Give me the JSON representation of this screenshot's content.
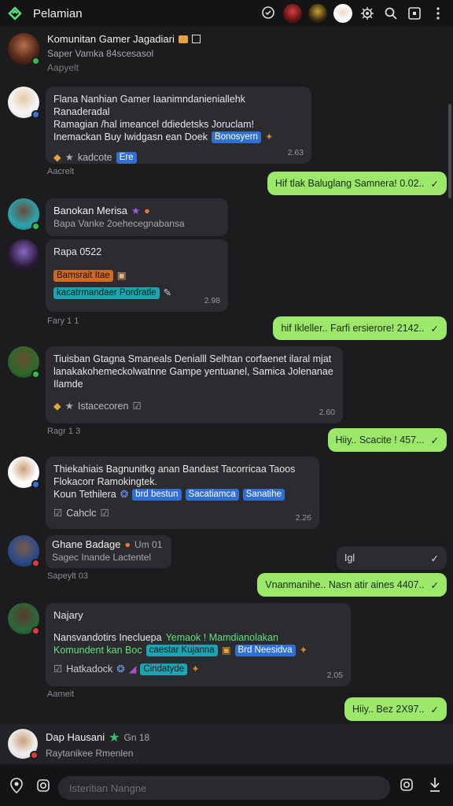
{
  "app": {
    "title": "Pelamian"
  },
  "header": {
    "icons": [
      "logo-icon",
      "chat-bubble-icon",
      "avatar-red",
      "avatar-dark",
      "avatar-white",
      "gear-icon",
      "search-icon",
      "window-icon",
      "more-icon"
    ]
  },
  "colors": {
    "bg": "#1c1c1e",
    "bubble": "#2c2c30",
    "outgoing": "#9be86a",
    "tag_blue": "#2f6fd6",
    "tag_cyan": "#1aa5b0",
    "tag_orange": "#d2691e"
  },
  "pinned": {
    "name": "Komunitan Gamer Jagadiari",
    "sub": "Saper Vamka  84scesasol",
    "meta": "Aapyelt"
  },
  "m1": {
    "l1": "Flana Nanhian Gamer Iaanimndanieniallehk Ranaderadal",
    "l2": "Ramagian /hal imeancel ddiedetsks Joruclam!",
    "l3": "Inemackan Buy Iwidgasn ean Doek",
    "tag": "Bonosyern",
    "react": "kadcote",
    "tag2": "Ere",
    "time": "2.63",
    "after": "Aacrelt"
  },
  "o1": {
    "text": "Hif tlak Baluglang Samnera! 0.02.."
  },
  "m2": {
    "name": "Banokan Merisa",
    "sub": "Bapa Vanke  2oehecegnabansa"
  },
  "m3": {
    "title": "Rapa  0522",
    "tag1": "Bamsrait Itae",
    "tag2": "kacatrmandaer Pordratle",
    "time": "2.98",
    "after": "Fary  1 1"
  },
  "o2": {
    "text": "hif Ikleller.. Farfi ersierore! 2142.."
  },
  "m4": {
    "l1": "Tiuisban Gtagna Smaneals Denialll Selhtan corfaenet ilaral mjat",
    "l2": "lanakakohemeckolwatnne Gampe yentuanel, Samica Jolenanae",
    "l3": "Ilamde",
    "react": "Istacecoren",
    "time": "2.60",
    "after": "Ragr 1 3"
  },
  "o3": {
    "text": "Hiiy.. Scacite ! 457..."
  },
  "m5": {
    "l1": "Thiekahiais Bagnunitkg anan Bandast Tacorricaa Taoos",
    "l2": "Flokacorr Ramokingtek.",
    "l3": "Koun Tethilera",
    "tags": [
      "brd bestun",
      "Sacatiamca",
      "Sanatihe"
    ],
    "check": "Cahclc",
    "time": "2.26"
  },
  "m6": {
    "name": "Ghane Badage",
    "badge": "Um 01",
    "sub": "Sagec Inande  Lactentel",
    "after": "Sapeylt  03"
  },
  "o4": {
    "text": "Igl"
  },
  "o5": {
    "text": "Vnanmanihe.. Nasn atir aines 4407.."
  },
  "m7": {
    "name": "Najary",
    "l1": "Nansvandotirs Inecluepa",
    "l1b": "Yemaok ! Mamdianolakan",
    "l2": "Komundent kan Boc",
    "tag1": "caestar Kujanna",
    "tag2": "Brd Neesidva",
    "check": "Hatkadock",
    "tag3": "Cindatyde",
    "time": "2.05",
    "after": "Aameit"
  },
  "o6": {
    "text": "Hiiy.. Bez 2X97.."
  },
  "bottom": {
    "name": "Dap Hausani",
    "badge": "Gn 18",
    "sub": "Raytanikee Rmenlen"
  },
  "composer": {
    "placeholder": "Isteritian Nangne"
  }
}
